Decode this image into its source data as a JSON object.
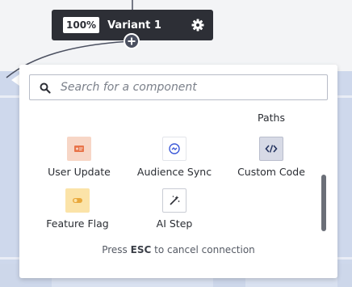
{
  "node": {
    "percent": "100%",
    "title": "Variant 1",
    "settings_icon": "gear-icon",
    "add_icon": "plus-circle-icon"
  },
  "picker": {
    "search_placeholder": "Search for a component",
    "partial_item_label": "Paths",
    "items": [
      {
        "label": "User Update",
        "icon": "user-card-icon",
        "color": "#f7d6c6"
      },
      {
        "label": "Audience Sync",
        "icon": "sync-icon",
        "color": "#ffffff"
      },
      {
        "label": "Custom Code",
        "icon": "code-icon",
        "color": "#d7dae6"
      },
      {
        "label": "Feature Flag",
        "icon": "toggle-icon",
        "color": "#fbe3a8"
      },
      {
        "label": "AI Step",
        "icon": "magic-wand-icon",
        "color": "#ffffff"
      }
    ],
    "footer_prefix": "Press",
    "footer_key": "ESC",
    "footer_suffix": "to cancel connection"
  },
  "colors": {
    "node_bg": "#2d2f36",
    "canvas_band": "#ced8ec",
    "accent_orange": "#e8744a",
    "accent_blue": "#3d5ad8"
  }
}
